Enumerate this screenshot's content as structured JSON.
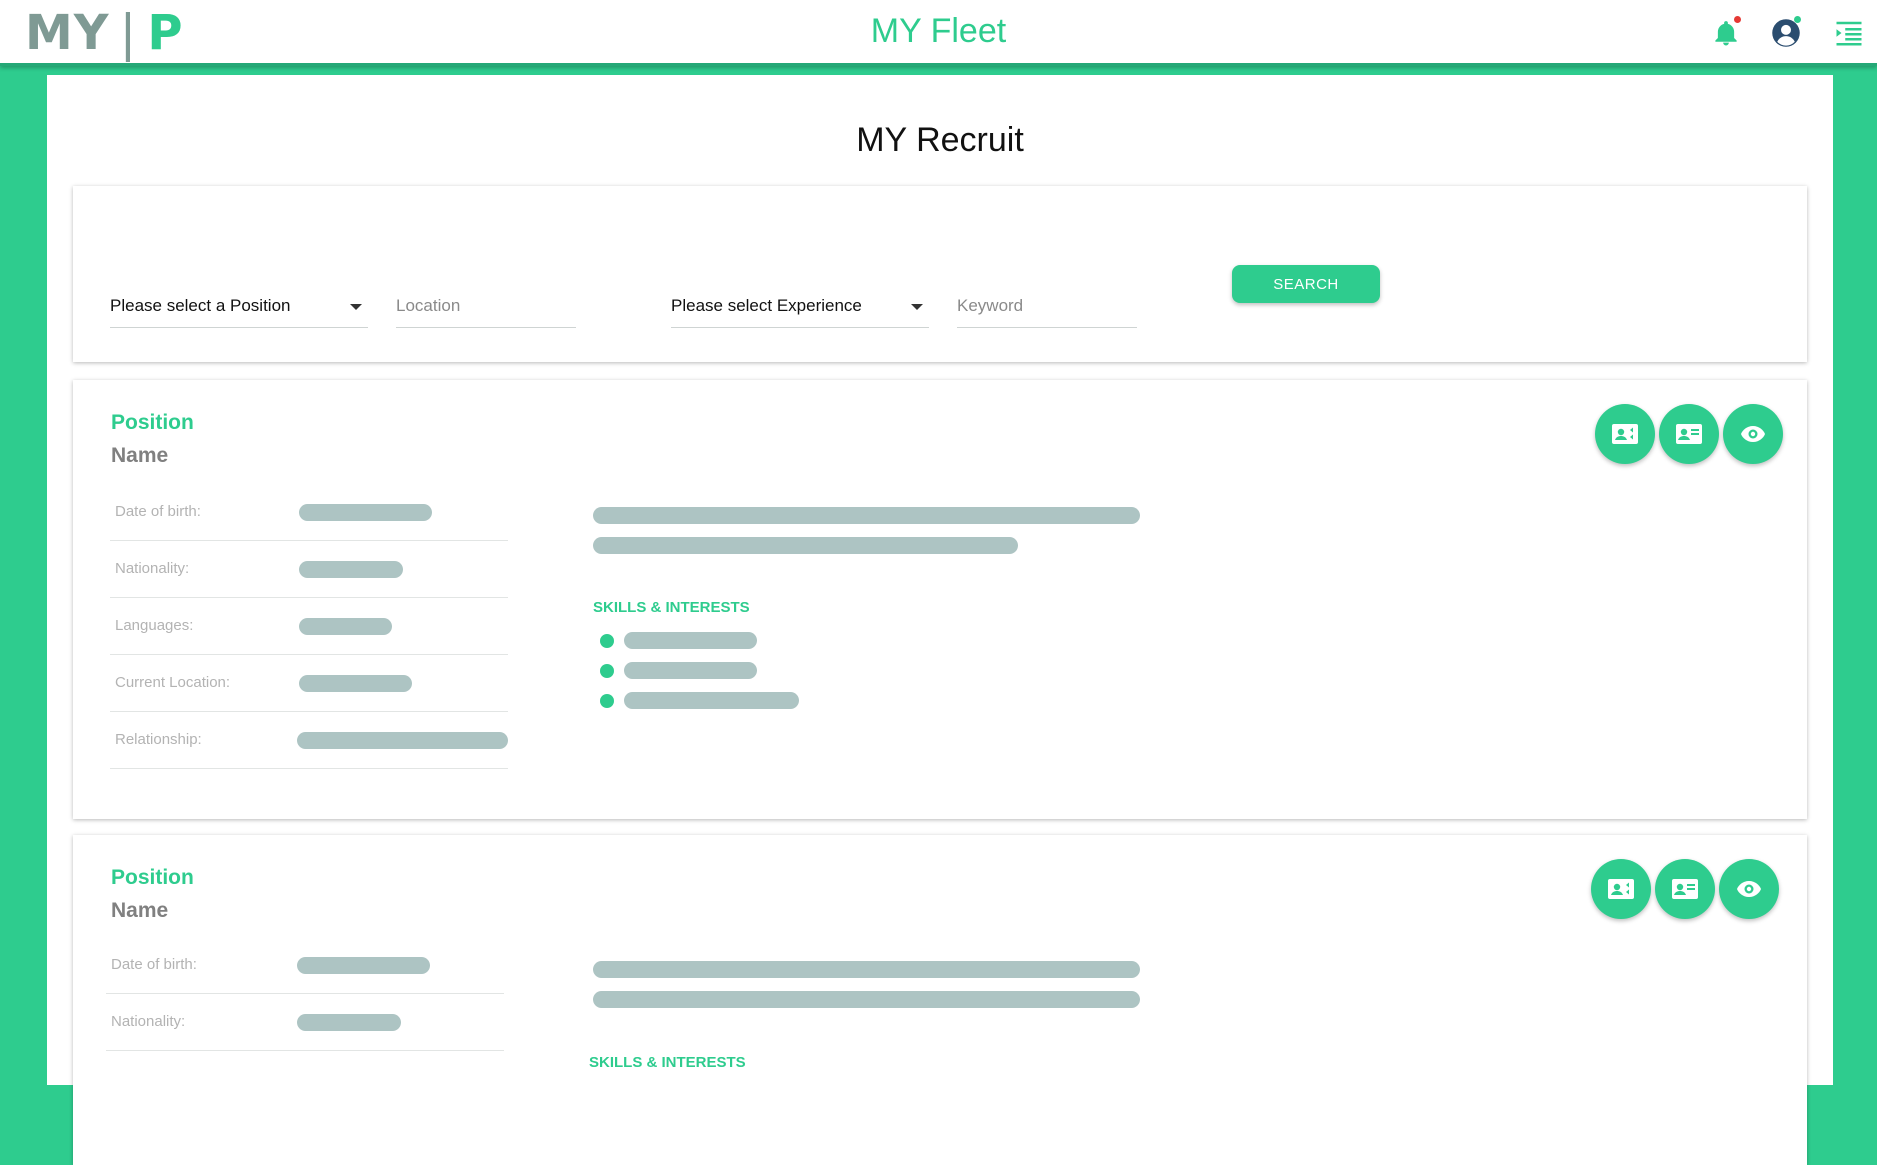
{
  "header": {
    "logo": {
      "left": "MY",
      "divider": "|",
      "right": "P"
    },
    "title": "MY Fleet",
    "icons": [
      "bell-icon",
      "user-icon",
      "menu-icon"
    ],
    "colors": {
      "accent": "#2ecc8e",
      "logo_gray": "#7f9a94",
      "notification_dot": "#e53935",
      "online_dot": "#2ecc8e"
    }
  },
  "page": {
    "title": "MY Recruit"
  },
  "search": {
    "position_select": "Please select a Position",
    "location_placeholder": "Location",
    "experience_select": "Please select Experience",
    "keyword_placeholder": "Keyword",
    "button_label": "SEARCH"
  },
  "profiles": [
    {
      "position_label": "Position",
      "name_label": "Name",
      "fields": [
        "Date of birth:",
        "Nationality:",
        "Languages:",
        "Current Location:",
        "Relationship:"
      ],
      "skills_title": "SKILLS & INTERESTS",
      "actions": [
        "contact-card-icon",
        "id-card-icon",
        "eye-icon"
      ]
    },
    {
      "position_label": "Position",
      "name_label": "Name",
      "fields": [
        "Date of birth:",
        "Nationality:"
      ],
      "skills_title": "SKILLS & INTERESTS",
      "actions": [
        "contact-card-icon",
        "id-card-icon",
        "eye-icon"
      ]
    }
  ]
}
